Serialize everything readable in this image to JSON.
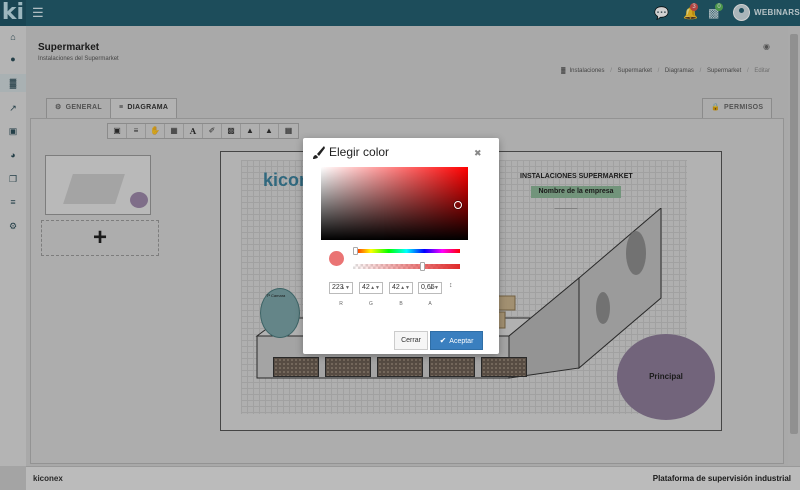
{
  "app": {
    "logo": "ki",
    "webinars": "WEBINARS",
    "notif_count": "3",
    "tasks_count": "0"
  },
  "page": {
    "title": "Supermarket",
    "subtitle": "Instalaciones del Supermarket",
    "breadcrumb": [
      "Instalaciones",
      "Supermarket",
      "Diagramas",
      "Supermarket",
      "Editar"
    ]
  },
  "tabs": {
    "general": "GENERAL",
    "diagrama": "DIAGRAMA",
    "permisos": "PERMISOS"
  },
  "diagram": {
    "title": "INSTALACIONES SUPERMARKET",
    "company": "Nombre de la empresa",
    "logo": "kiconex",
    "temp_label": "Tª Camara",
    "principal": "Principal"
  },
  "add_symbol": "+",
  "modal": {
    "title": "Elegir color",
    "color": {
      "r": "223",
      "g": "42",
      "b": "42",
      "a": "0,65"
    },
    "labels": {
      "r": "R",
      "g": "G",
      "b": "B",
      "a": "A"
    },
    "cancel_label": "Cerrar",
    "accept_label": "Aceptar"
  },
  "footer": {
    "brand": "kiconex",
    "tagline": "Plataforma de supervisión industrial"
  },
  "colors": {
    "topbar": "#245e70",
    "accent": "#3a7fbf",
    "principal": "#8b7a97"
  }
}
